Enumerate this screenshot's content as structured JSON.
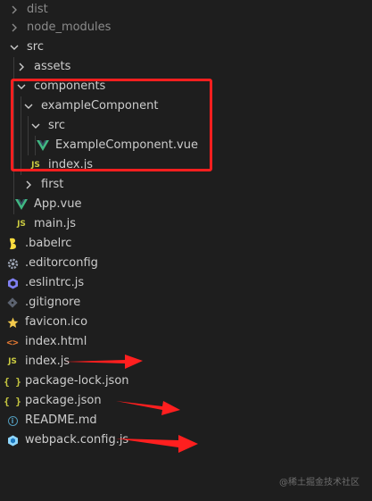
{
  "explorer": {
    "items": [
      {
        "label": "dist",
        "type": "folder",
        "state": "collapsed",
        "icon": "chevron-right-icon",
        "muted": true
      },
      {
        "label": "node_modules",
        "type": "folder",
        "state": "collapsed",
        "icon": "chevron-right-icon",
        "muted": true
      },
      {
        "label": "src",
        "type": "folder",
        "state": "expanded",
        "icon": "chevron-down-icon"
      },
      {
        "label": "assets",
        "type": "folder",
        "state": "collapsed",
        "icon": "chevron-right-icon"
      },
      {
        "label": "components",
        "type": "folder",
        "state": "expanded",
        "icon": "chevron-down-icon"
      },
      {
        "label": "exampleComponent",
        "type": "folder",
        "state": "expanded",
        "icon": "chevron-down-icon"
      },
      {
        "label": "src",
        "type": "folder",
        "state": "expanded",
        "icon": "chevron-down-icon"
      },
      {
        "label": "ExampleComponent.vue",
        "type": "file",
        "icon": "vue-icon"
      },
      {
        "label": "index.js",
        "type": "file",
        "icon": "js-icon"
      },
      {
        "label": "first",
        "type": "folder",
        "state": "collapsed",
        "icon": "chevron-right-icon"
      },
      {
        "label": "App.vue",
        "type": "file",
        "icon": "vue-icon"
      },
      {
        "label": "main.js",
        "type": "file",
        "icon": "js-icon"
      },
      {
        "label": ".babelrc",
        "type": "file",
        "icon": "babel-icon"
      },
      {
        "label": ".editorconfig",
        "type": "file",
        "icon": "gear-icon"
      },
      {
        "label": ".eslintrc.js",
        "type": "file",
        "icon": "eslint-icon"
      },
      {
        "label": ".gitignore",
        "type": "file",
        "icon": "git-icon"
      },
      {
        "label": "favicon.ico",
        "type": "file",
        "icon": "star-icon"
      },
      {
        "label": "index.html",
        "type": "file",
        "icon": "html-icon"
      },
      {
        "label": "index.js",
        "type": "file",
        "icon": "js-icon"
      },
      {
        "label": "package-lock.json",
        "type": "file",
        "icon": "json-icon"
      },
      {
        "label": "package.json",
        "type": "file",
        "icon": "json-icon"
      },
      {
        "label": "README.md",
        "type": "file",
        "icon": "info-icon"
      },
      {
        "label": "webpack.config.js",
        "type": "file",
        "icon": "webpack-icon"
      }
    ],
    "icon_glyphs": {
      "js": "JS",
      "json": "{ }",
      "html": "<>",
      "info": "i"
    }
  },
  "annotations": {
    "highlight_color": "#ff1f1f"
  },
  "watermark": "@稀土掘金技术社区",
  "colors": {
    "background": "#1e1e1e",
    "text": "#cccccc",
    "muted_text": "#8b8b8b",
    "vue_green": "#41b883",
    "js_yellow": "#cbcb41",
    "json_yellow": "#cbcb41",
    "html_orange": "#e37933",
    "info_blue": "#519aba",
    "eslint_purple": "#8080f2",
    "webpack_blue": "#8ed6fb",
    "gear_gray": "#9da5b4",
    "star_yellow": "#f2c94c",
    "babel_yellow": "#f9dc3e",
    "git_gray": "#5c6370"
  }
}
